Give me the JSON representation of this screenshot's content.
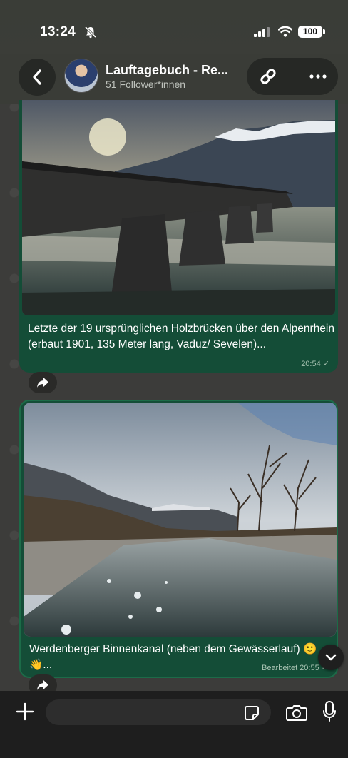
{
  "status": {
    "time": "13:24",
    "battery": "100"
  },
  "header": {
    "title": "Lauftagebuch - Re...",
    "subtitle": "51 Follower*innen"
  },
  "messages": [
    {
      "caption": "Letzte der 19 ursprünglichen Holzbrücken über den Alpenrhein (erbaut 1901, 135 Meter lang, Vaduz/ Sevelen)...",
      "meta": "20:54 ✓"
    },
    {
      "caption": "Werdenberger Binnenkanal (neben dem Gewässerlauf) 🙂 👋...",
      "meta": "Bearbeitet 20:55 ✓"
    }
  ],
  "composer": {
    "placeholder": ""
  },
  "colors": {
    "bubble": "#144d37",
    "header": "#3a3c37",
    "composer": "#1e1e1e"
  }
}
